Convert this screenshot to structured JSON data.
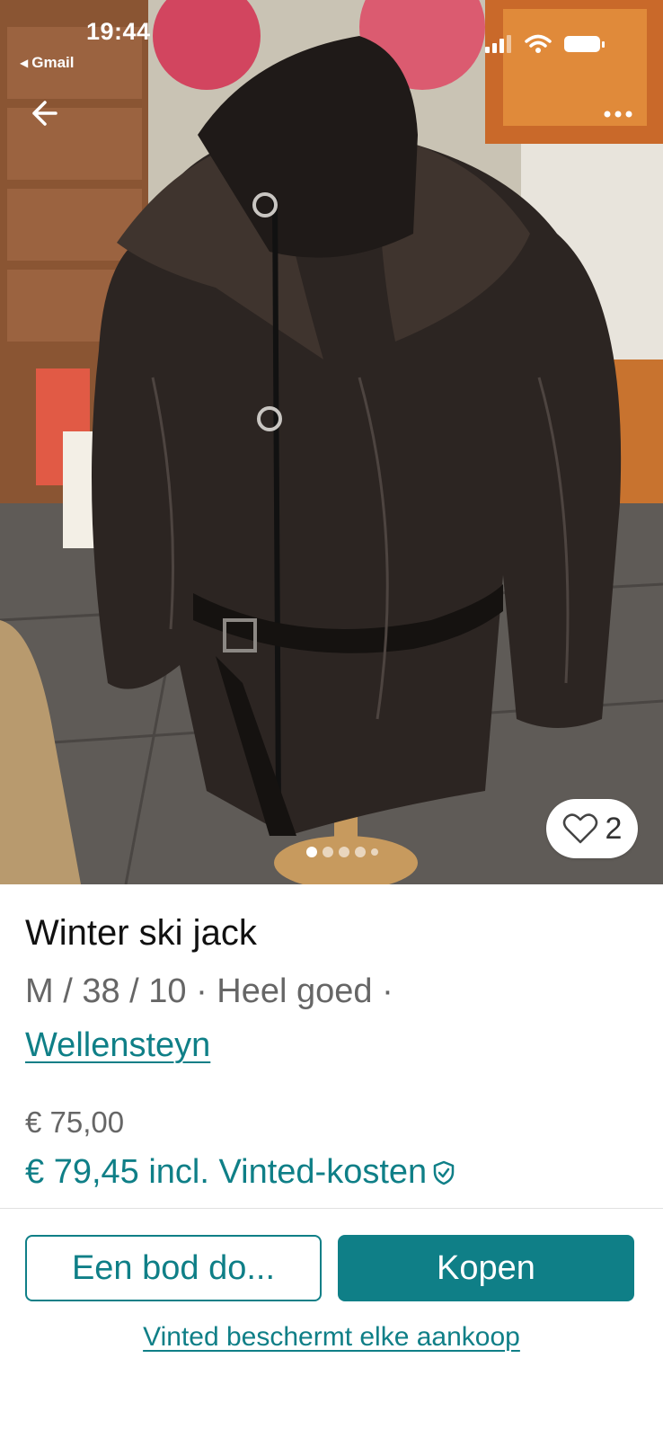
{
  "status_bar": {
    "time": "19:44",
    "back_app_label": "Gmail"
  },
  "photo": {
    "description_icon": "jacket-photo",
    "like_count": "2",
    "carousel_total": 5,
    "carousel_index": 1
  },
  "listing": {
    "title": "Winter ski jack",
    "meta": "M / 38 / 10 · Heel goed ·",
    "brand": "Wellensteyn",
    "price": "€ 75,00",
    "price_incl": "€ 79,45 incl. Vinted-kosten"
  },
  "actions": {
    "offer_label": "Een bod do...",
    "buy_label": "Kopen",
    "protection_link": "Vinted beschermt elke aankoop"
  },
  "colors": {
    "accent": "#0f7f87",
    "muted_text": "#666666"
  }
}
